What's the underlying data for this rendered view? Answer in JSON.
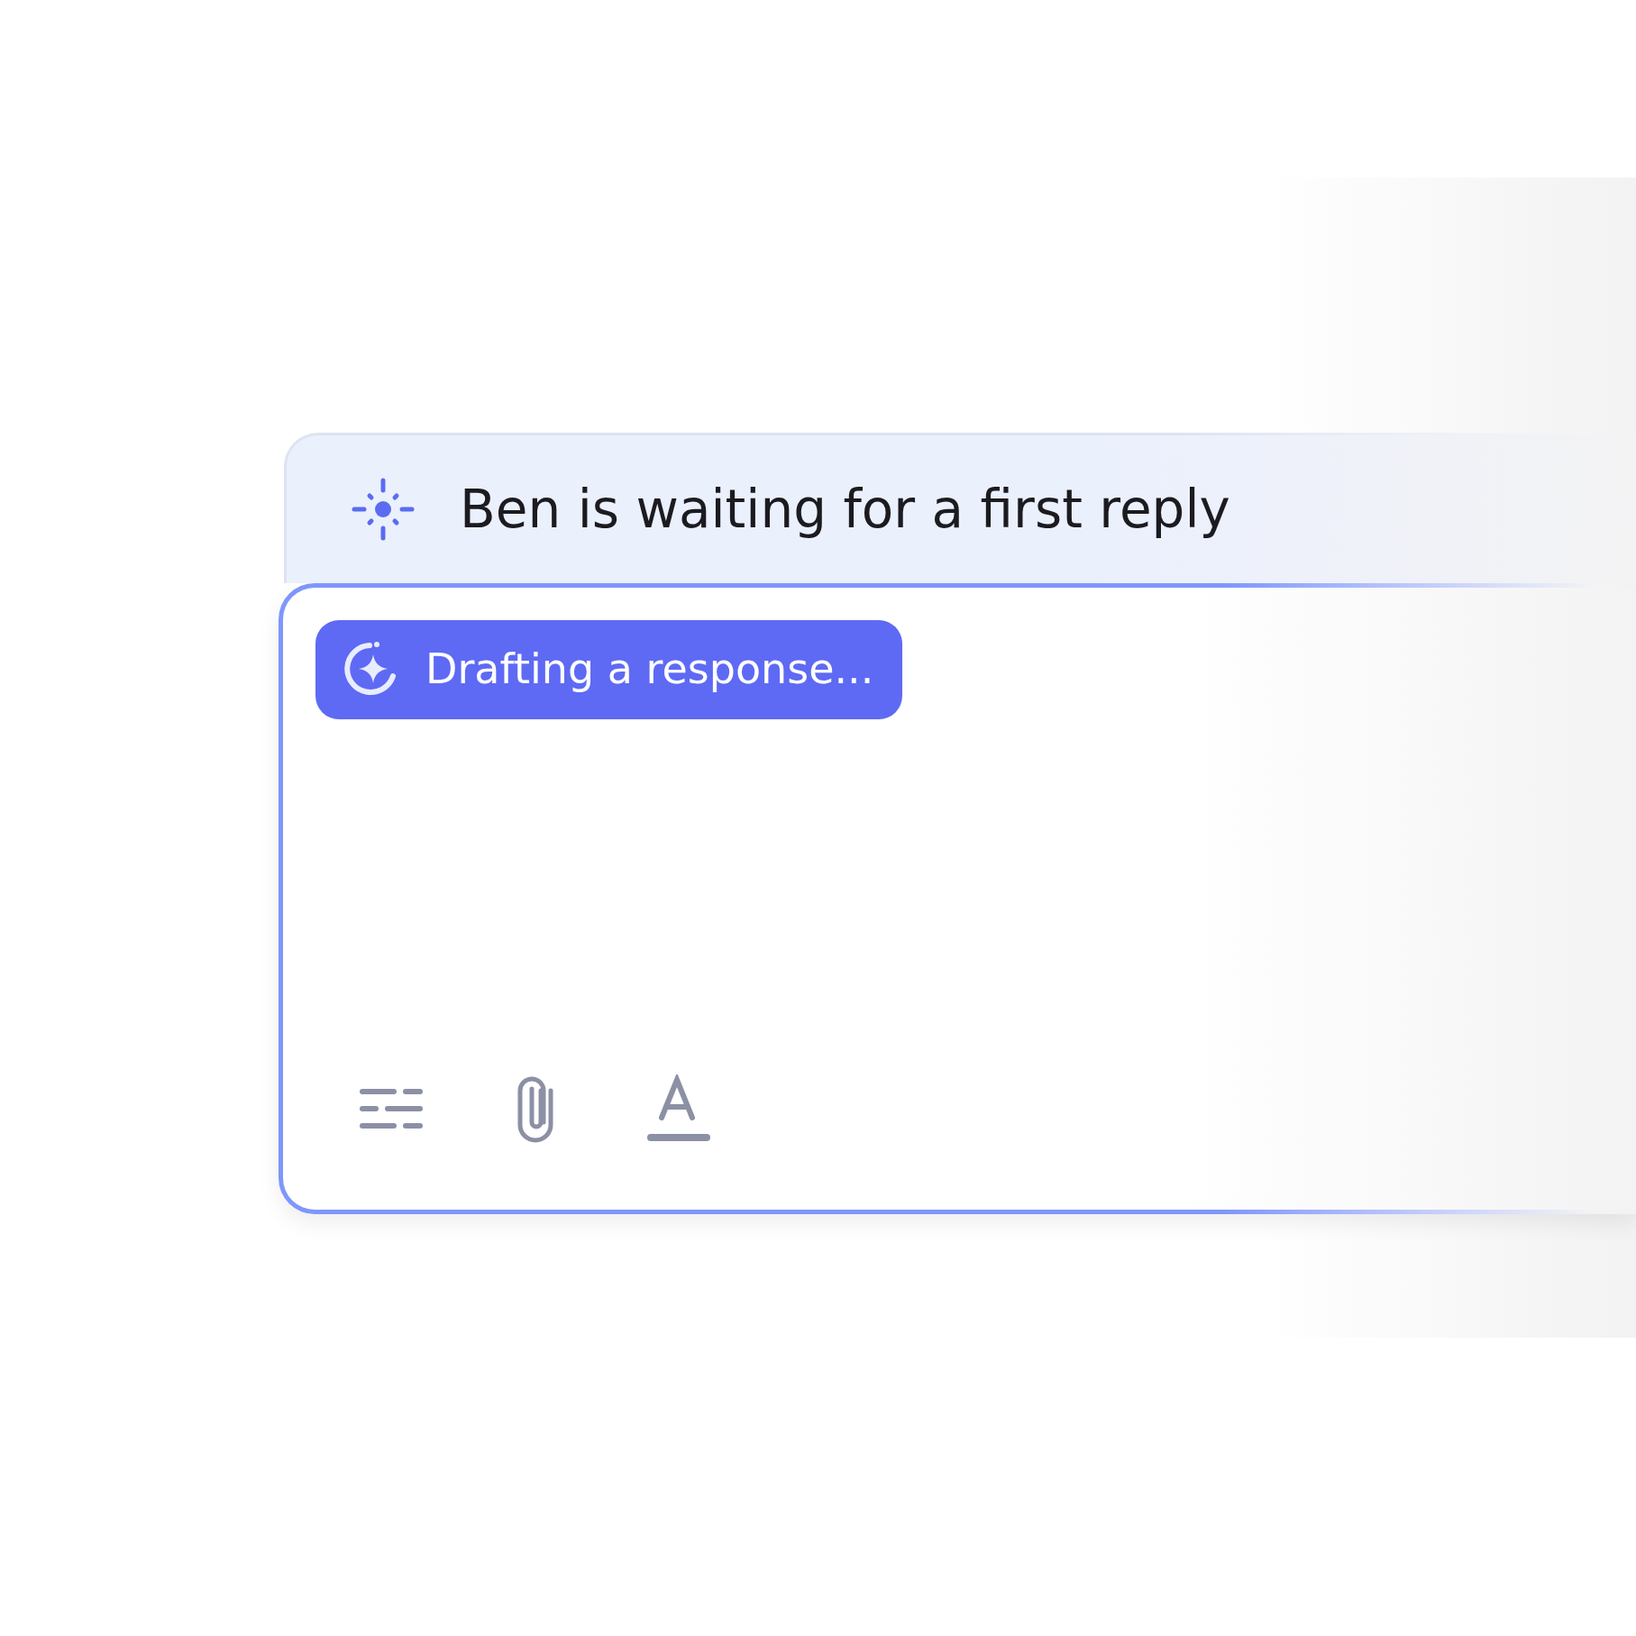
{
  "banner": {
    "text": "Ben is waiting for a first reply"
  },
  "composer": {
    "status": {
      "label": "Drafting a response..."
    }
  }
}
